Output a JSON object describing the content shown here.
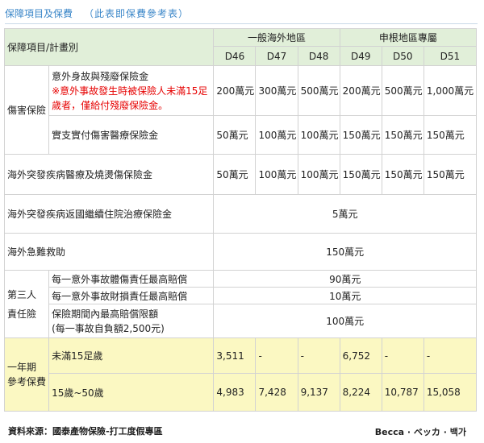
{
  "title": {
    "main": "保障項目及保費",
    "note": "（此表即保費參考表）"
  },
  "header": {
    "item_col": "保障項目/計畫別",
    "group1": "一般海外地區",
    "group2": "申根地區專屬",
    "plans": [
      "D46",
      "D47",
      "D48",
      "D49",
      "D50",
      "D51"
    ]
  },
  "injury": {
    "label": "傷害保險",
    "death_label": "意外身故與殘廢保險金",
    "death_note": "※意外事故發生時被保險人未滿15足歲者，僅給付殘廢保險金。",
    "death_values": [
      "200萬元",
      "300萬元",
      "500萬元",
      "200萬元",
      "500萬元",
      "1,000萬元"
    ],
    "medical_label": "實支實付傷害醫療保險金",
    "medical_values": [
      "50萬元",
      "100萬元",
      "100萬元",
      "150萬元",
      "150萬元",
      "150萬元"
    ]
  },
  "illness": {
    "label": "海外突發疾病醫療及燒燙傷保險金",
    "values": [
      "50萬元",
      "100萬元",
      "100萬元",
      "150萬元",
      "150萬元",
      "150萬元"
    ]
  },
  "return_treatment": {
    "label": "海外突發疾病返國繼續住院治療保險金",
    "value": "5萬元"
  },
  "rescue": {
    "label": "海外急難救助",
    "value": "150萬元"
  },
  "liability": {
    "label_line1": "第三人",
    "label_line2": "責任險",
    "bodily_label": "每一意外事故體傷責任最高賠償",
    "bodily_value": "90萬元",
    "property_label": "每一意外事故財損責任最高賠償",
    "property_value": "10萬元",
    "period_label_line1": "保險期間內最高賠償限額",
    "period_label_line2": "(每一事故自負額2,500元)",
    "period_value": "100萬元"
  },
  "premium": {
    "label_line1": "一年期",
    "label_line2": "參考保費",
    "under15_label": "未滿15足歲",
    "under15_values": [
      "3,511",
      "-",
      "-",
      "6,752",
      "-",
      "-"
    ],
    "adult_label": "15歲~50歲",
    "adult_values": [
      "4,983",
      "7,428",
      "9,137",
      "8,224",
      "10,787",
      "15,058"
    ]
  },
  "footer": {
    "source": "資料來源：國泰產物保險-打工度假專區",
    "credit": "Becca · ベッカ · 백가"
  }
}
